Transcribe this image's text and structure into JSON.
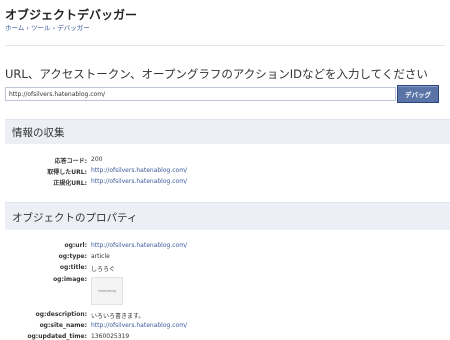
{
  "header": {
    "title": "オブジェクトデバッガー",
    "breadcrumb": "ホーム › ツール › デバッガー"
  },
  "search": {
    "prompt": "URL、アクセストークン、オープングラフのアクションIDなどを入力してください",
    "value": "http://ofsilvers.hatenablog.com/",
    "button_label": "デバッグ"
  },
  "info": {
    "heading": "情報の収集",
    "rows": [
      {
        "label": "応答コード:",
        "value": "200"
      },
      {
        "label": "取得したURL:",
        "value": "http://ofsilvers.hatenablog.com/"
      },
      {
        "label": "正規化URL:",
        "value": "http://ofsilvers.hatenablog.com/"
      }
    ]
  },
  "props": {
    "heading": "オブジェクトのプロパティ",
    "rows": [
      {
        "label": "og:url:",
        "value": "http://ofsilvers.hatenablog.com/"
      },
      {
        "label": "og:type:",
        "value": "article"
      },
      {
        "label": "og:title:",
        "value": "しろろぐ"
      },
      {
        "label": "og:image:",
        "value": "hatenablog"
      },
      {
        "label": "og:description:",
        "value": "いろいろ書きます。"
      },
      {
        "label": "og:site_name:",
        "value": "http://ofsilvers.hatenablog.com/"
      },
      {
        "label": "og:updated_time:",
        "value": "1360025319"
      }
    ]
  },
  "colors": {
    "link": "#3b5998",
    "button": "#5b74a8",
    "section_bg": "#eceff5"
  }
}
